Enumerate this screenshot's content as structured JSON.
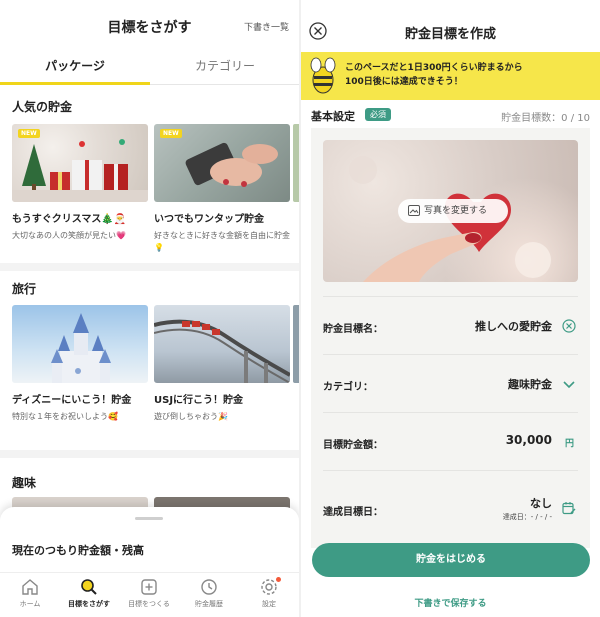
{
  "left": {
    "title": "目標をさがす",
    "draft_list": "下書き一覧",
    "tabs": [
      "パッケージ",
      "カテゴリー"
    ],
    "sections": [
      {
        "title": "人気の貯金",
        "cards": [
          {
            "badge": "NEW",
            "title": "もうすぐクリスマス🎄🎅",
            "desc": "大切なあの人の笑顔が見たい💗"
          },
          {
            "badge": "NEW",
            "title": "いつでもワンタップ貯金",
            "desc": "好きなときに好きな金額を自由に貯金💡"
          }
        ]
      },
      {
        "title": "旅行",
        "cards": [
          {
            "title": "ディズニーにいこう！貯金",
            "desc": "特別な１年をお祝いしよう🥰"
          },
          {
            "title": "USJに行こう！貯金",
            "desc": "遊び倒しちゃおう🎉"
          }
        ]
      },
      {
        "title": "趣味"
      }
    ],
    "sheet_title": "現在のつもり貯金額・残高",
    "nav": [
      {
        "label": "ホーム",
        "icon": "home-icon"
      },
      {
        "label": "目標をさがす",
        "icon": "search-icon"
      },
      {
        "label": "目標をつくる",
        "icon": "plus-square-icon"
      },
      {
        "label": "貯金履歴",
        "icon": "history-icon"
      },
      {
        "label": "設定",
        "icon": "gear-icon"
      }
    ]
  },
  "right": {
    "title": "貯金目標を作成",
    "banner_line1": "このペースだと1日300円くらい貯まるから",
    "banner_line2": "100日後には達成できそう！",
    "basic_label": "基本設定",
    "required": "必須",
    "goal_count_label": "貯金目標数：0 / 10",
    "photo_button": "写真を変更する",
    "fields": {
      "name_label": "貯金目標名：",
      "name_value": "推しへの愛貯金",
      "category_label": "カテゴリ：",
      "category_value": "趣味貯金",
      "amount_label": "目標貯金額：",
      "amount_value": "30,000",
      "amount_unit": "円",
      "date_label": "達成目標日：",
      "date_value": "なし",
      "date_sub": "達成日：- / - / -"
    },
    "start_button": "貯金をはじめる",
    "save_draft": "下書きで保存する"
  },
  "colors": {
    "accent_yellow": "#f0d51a",
    "brand_green": "#3e9b85",
    "banner_yellow": "#f6e64a",
    "notify_red": "#f35a3a"
  }
}
